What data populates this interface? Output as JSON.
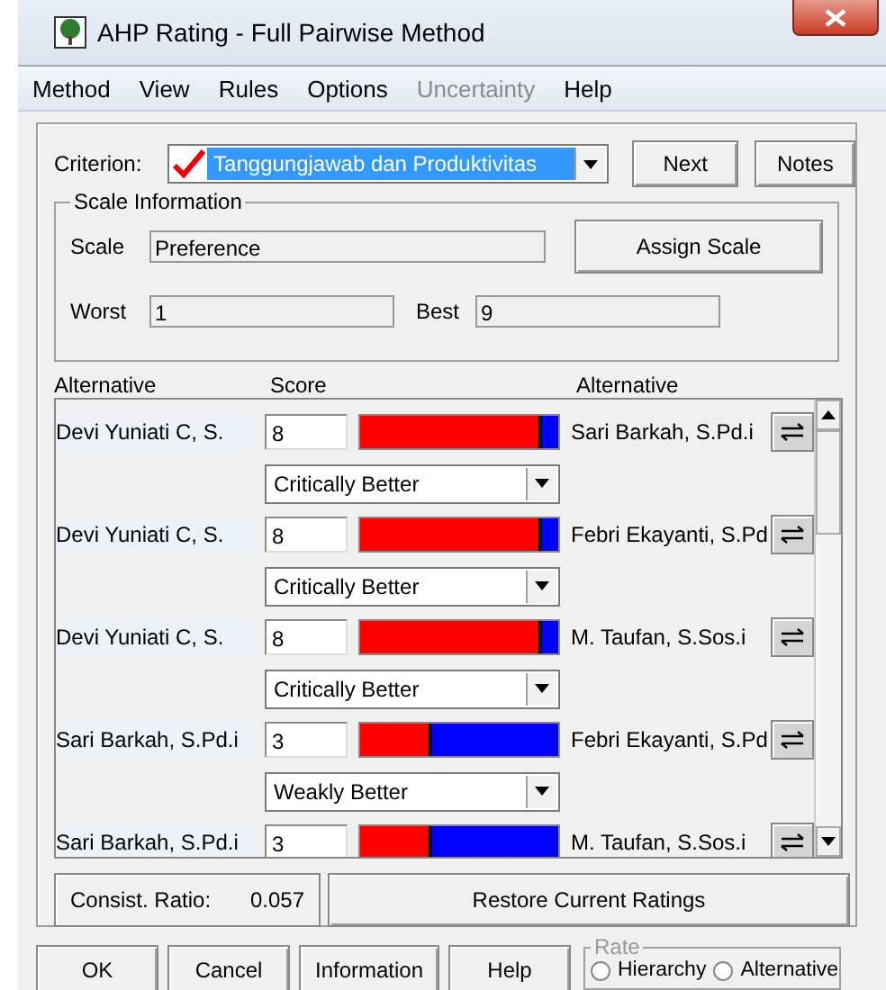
{
  "window": {
    "title": "AHP Rating - Full Pairwise Method"
  },
  "menu": [
    {
      "label": "Method",
      "disabled": false
    },
    {
      "label": "View",
      "disabled": false
    },
    {
      "label": "Rules",
      "disabled": false
    },
    {
      "label": "Options",
      "disabled": false
    },
    {
      "label": "Uncertainty",
      "disabled": true
    },
    {
      "label": "Help",
      "disabled": false
    }
  ],
  "criterion": {
    "label": "Criterion:",
    "value": "Tanggungjawab dan Produktivitas",
    "next_button": "Next",
    "notes_button": "Notes"
  },
  "scale_information": {
    "title": "Scale Information",
    "scale_label": "Scale",
    "scale_value": "Preference",
    "assign_button": "Assign Scale",
    "worst_label": "Worst",
    "worst_value": "1",
    "best_label": "Best",
    "best_value": "9"
  },
  "columns": [
    "Alternative",
    "Score",
    "Alternative"
  ],
  "comparisons": [
    {
      "left": "Devi Yuniati C, S.",
      "score": "8",
      "level": 0.92,
      "right": "Sari Barkah, S.Pd.i",
      "verbal": "Critically Better"
    },
    {
      "left": "Devi Yuniati C, S.",
      "score": "8",
      "level": 0.92,
      "right": "Febri Ekayanti, S.Pd",
      "verbal": "Critically Better"
    },
    {
      "left": "Devi Yuniati C, S.",
      "score": "8",
      "level": 0.92,
      "right": "M. Taufan, S.Sos.i",
      "verbal": "Critically Better"
    },
    {
      "left": "Sari Barkah, S.Pd.i",
      "score": "3",
      "level": 0.36,
      "right": "Febri Ekayanti, S.Pd",
      "verbal": "Weakly Better"
    },
    {
      "left": "Sari Barkah, S.Pd.i",
      "score": "3",
      "level": 0.36,
      "right": "M. Taufan, S.Sos.i"
    }
  ],
  "consistency": {
    "label": "Consist. Ratio:",
    "value": "0.057"
  },
  "restore_button": "Restore Current Ratings",
  "buttons": [
    "OK",
    "Cancel",
    "Information",
    "Help"
  ],
  "rate": {
    "title": "Rate",
    "options": [
      {
        "label": "Hierarchy",
        "selected": false
      },
      {
        "label": "Alternative",
        "selected": false
      }
    ]
  }
}
